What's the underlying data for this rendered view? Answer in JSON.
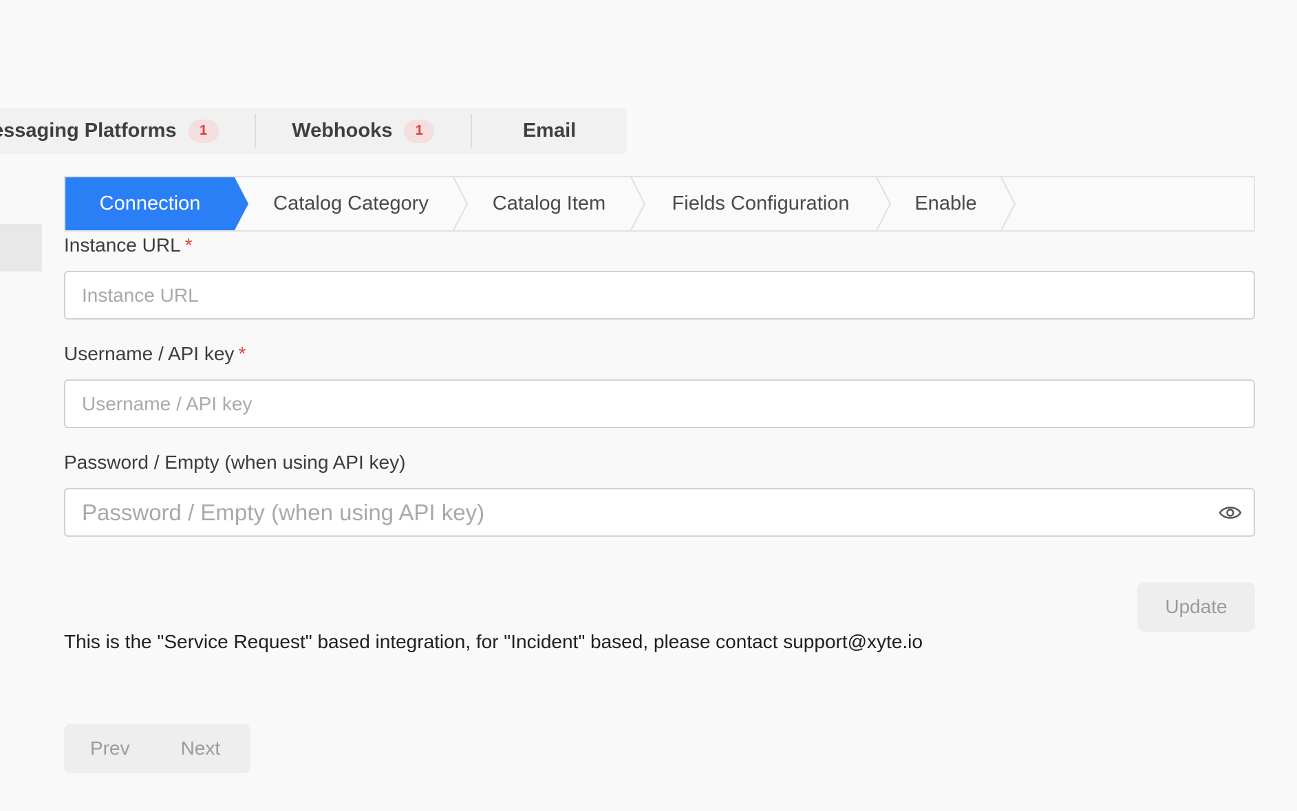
{
  "top_tabs": [
    {
      "label": "essaging Platforms",
      "badge": "1"
    },
    {
      "label": "Webhooks",
      "badge": "1"
    },
    {
      "label": "Email",
      "badge": ""
    }
  ],
  "steps": [
    {
      "label": "Connection",
      "active": true
    },
    {
      "label": "Catalog Category",
      "active": false
    },
    {
      "label": "Catalog Item",
      "active": false
    },
    {
      "label": "Fields Configuration",
      "active": false
    },
    {
      "label": "Enable",
      "active": false
    }
  ],
  "form": {
    "instance_url": {
      "label": "Instance URL",
      "required_mark": "*",
      "placeholder": "Instance URL",
      "value": ""
    },
    "username": {
      "label": "Username / API key",
      "required_mark": "*",
      "placeholder": "Username / API key",
      "value": ""
    },
    "password": {
      "label": "Password / Empty (when using API key)",
      "placeholder": "Password / Empty (when using API key)",
      "value": ""
    }
  },
  "update_label": "Update",
  "info_text": "This is the \"Service Request\" based integration, for \"Incident\" based, please contact support@xyte.io",
  "pager": {
    "prev_label": "Prev",
    "next_label": "Next"
  },
  "colors": {
    "accent": "#2a7ef6",
    "badge_bg": "#f5dede",
    "badge_text": "#e03b3b",
    "required": "#e0433f"
  },
  "icons": {
    "password_toggle": "eye-icon"
  }
}
